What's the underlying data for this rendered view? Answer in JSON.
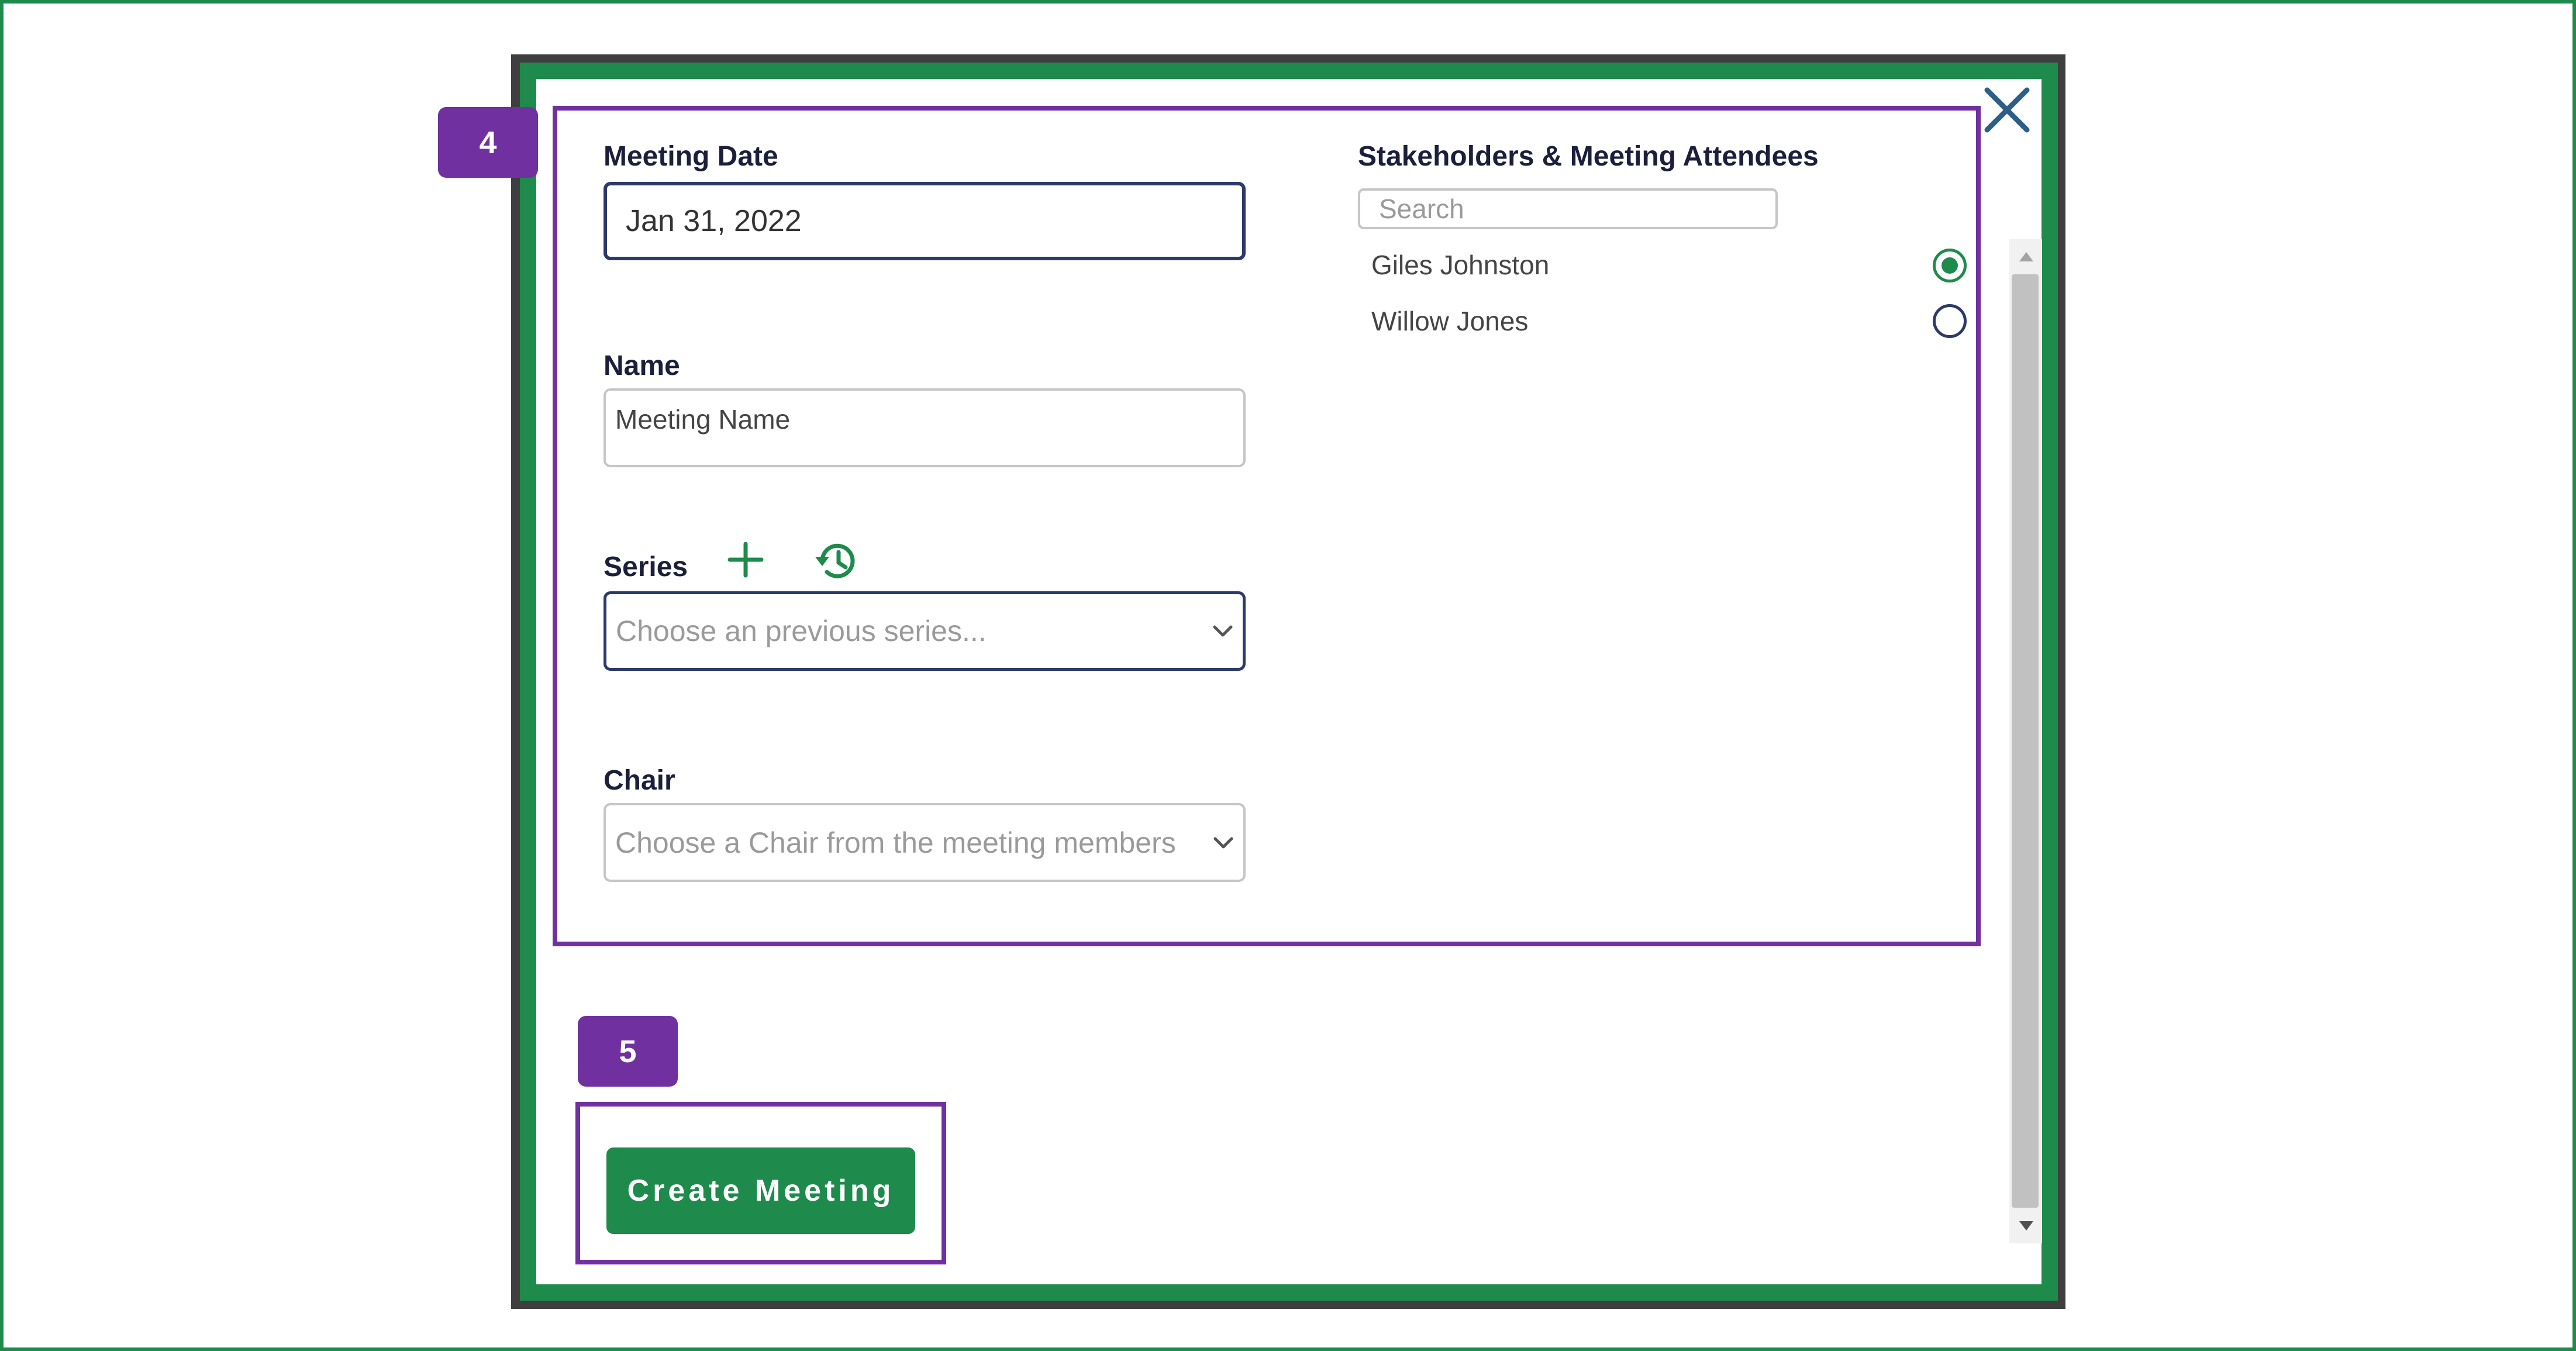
{
  "annotations": {
    "form_badge": "4",
    "submit_badge": "5"
  },
  "form": {
    "meeting_date": {
      "label": "Meeting Date",
      "value": "Jan 31, 2022"
    },
    "name": {
      "label": "Name",
      "placeholder": "Meeting Name"
    },
    "series": {
      "label": "Series",
      "selected": "Choose an previous series..."
    },
    "chair": {
      "label": "Chair",
      "selected": "Choose a Chair from the meeting members"
    }
  },
  "attendees": {
    "label": "Stakeholders & Meeting Attendees",
    "search_placeholder": "Search",
    "items": [
      {
        "name": "Giles Johnston",
        "selected": true
      },
      {
        "name": "Willow Jones",
        "selected": false
      }
    ]
  },
  "actions": {
    "create_label": "Create Meeting"
  },
  "icons": {
    "close": "close-icon",
    "add_series": "plus-icon",
    "previous_series": "history-icon",
    "dropdown": "chevron-down-icon"
  },
  "colors": {
    "brand_green": "#1e8a4c",
    "annotation_purple": "#7030a0",
    "input_border_navy": "#2b3a6b",
    "label_text": "#1b1f3b"
  }
}
